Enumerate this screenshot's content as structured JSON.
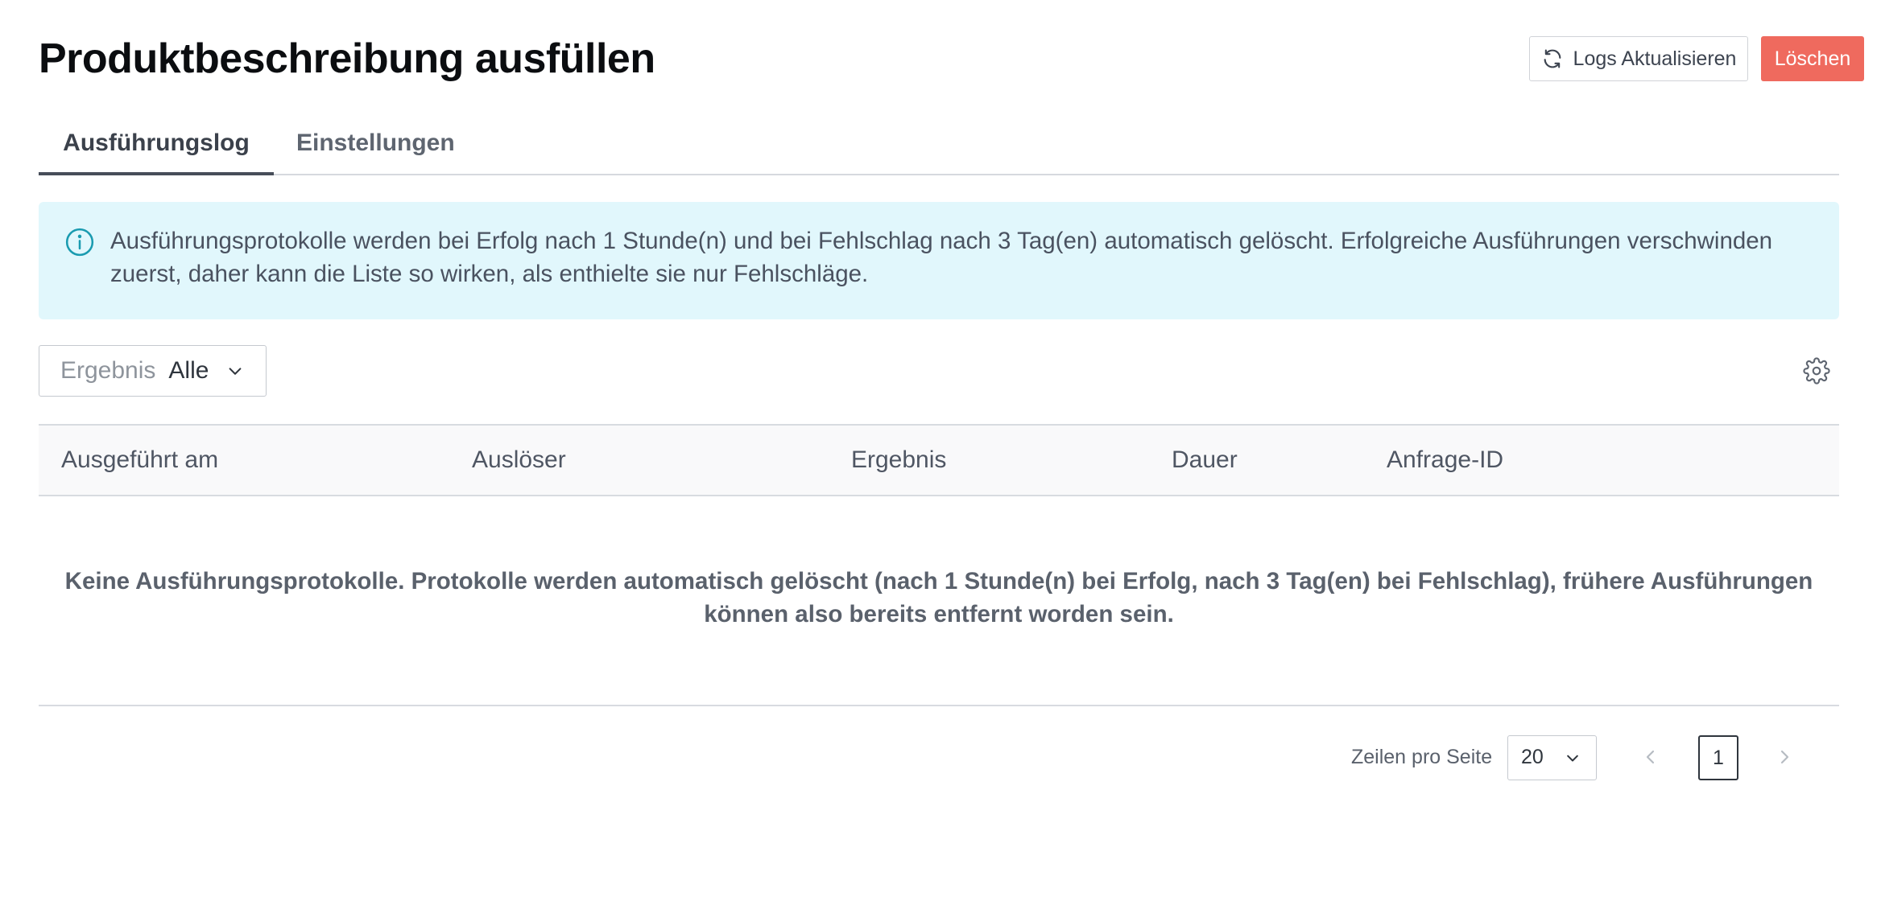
{
  "page": {
    "title": "Produktbeschreibung ausfüllen"
  },
  "actions": {
    "refresh_label": "Logs Aktualisieren",
    "delete_label": "Löschen"
  },
  "tabs": [
    {
      "label": "Ausführungslog",
      "active": true
    },
    {
      "label": "Einstellungen",
      "active": false
    }
  ],
  "info_banner": {
    "line1": "Ausführungsprotokolle werden bei Erfolg nach 1 Stunde(n) und bei Fehlschlag nach 3 Tag(en) automatisch gelöscht. Erfolgreiche Ausführungen verschwinden",
    "line2": "zuerst, daher kann die Liste so wirken, als enthielte sie nur Fehlschläge."
  },
  "filter": {
    "label": "Ergebnis",
    "value": "Alle"
  },
  "table": {
    "columns": [
      "Ausgeführt am",
      "Auslöser",
      "Ergebnis",
      "Dauer",
      "Anfrage-ID"
    ],
    "empty_line1": "Keine Ausführungsprotokolle. Protokolle werden automatisch gelöscht (nach 1 Stunde(n) bei Erfolg, nach 3 Tag(en) bei Fehlschlag), frühere Ausführungen",
    "empty_line2": "können also bereits entfernt worden sein."
  },
  "pagination": {
    "rows_label": "Zeilen pro Seite",
    "rows_value": "20",
    "current_page": "1"
  },
  "colors": {
    "delete_button": "#ef6a5e",
    "info_background": "#e1f7fc",
    "info_icon": "#1a9bb0"
  },
  "icons": {
    "refresh": "refresh-icon",
    "info": "info-icon",
    "chevron": "chevron-down-icon",
    "settings": "gear-icon"
  }
}
